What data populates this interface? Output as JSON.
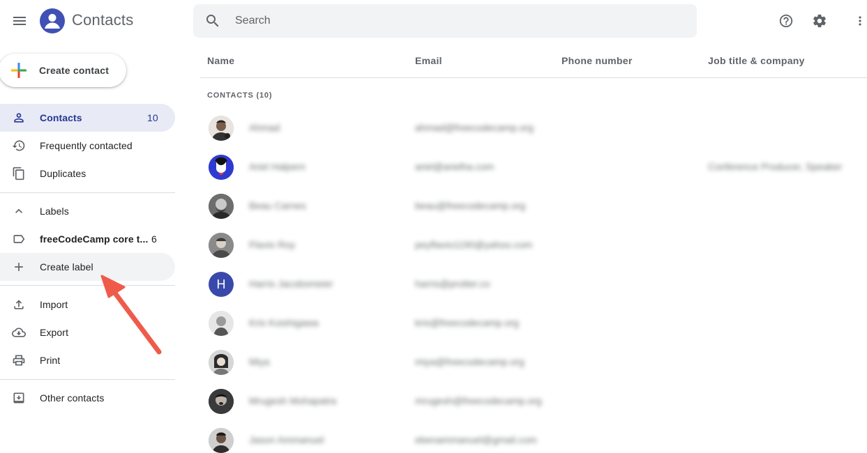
{
  "app": {
    "title": "Contacts"
  },
  "search": {
    "placeholder": "Search"
  },
  "sidebar": {
    "create_contact": "Create contact",
    "nav": [
      {
        "label": "Contacts",
        "count": "10"
      },
      {
        "label": "Frequently contacted"
      },
      {
        "label": "Duplicates"
      }
    ],
    "labels_header": "Labels",
    "label_items": [
      {
        "label": "freeCodeCamp core t...",
        "count": "6"
      }
    ],
    "create_label": "Create label",
    "actions": [
      {
        "label": "Import"
      },
      {
        "label": "Export"
      },
      {
        "label": "Print"
      }
    ],
    "other_contacts": "Other contacts"
  },
  "table": {
    "columns": [
      "Name",
      "Email",
      "Phone number",
      "Job title & company"
    ],
    "section_title": "CONTACTS (10)",
    "rows": [
      {
        "avatar_initial": "",
        "name": "Ahmad",
        "email": "ahmad@freecodecamp.org",
        "job": ""
      },
      {
        "avatar_initial": "",
        "name": "Ariel Halpern",
        "email": "ariel@arielha.com",
        "job": "Conference Producer, Speaker"
      },
      {
        "avatar_initial": "",
        "name": "Beau Carnes",
        "email": "beau@freecodecamp.org",
        "job": ""
      },
      {
        "avatar_initial": "",
        "name": "Flavio Roy",
        "email": "peyflavio1190@yahoo.com",
        "job": ""
      },
      {
        "avatar_initial": "H",
        "name": "Harris Jacobsmeier",
        "email": "harris@protter.co",
        "job": ""
      },
      {
        "avatar_initial": "",
        "name": "Kris Koishigawa",
        "email": "kris@freecodecamp.org",
        "job": ""
      },
      {
        "avatar_initial": "",
        "name": "Miya",
        "email": "miya@freecodecamp.org",
        "job": ""
      },
      {
        "avatar_initial": "",
        "name": "Mrugesh Mohapatra",
        "email": "mrugesh@freecodecamp.org",
        "job": ""
      },
      {
        "avatar_initial": "",
        "name": "Jason Ammanuel",
        "email": "ebenammanuel@gmail.com",
        "job": ""
      }
    ]
  },
  "colors": {
    "accent": "#283593",
    "active_bg": "#e8eaf5",
    "logo_bg": "#3f51b5",
    "arrow": "#ef5b4b"
  }
}
